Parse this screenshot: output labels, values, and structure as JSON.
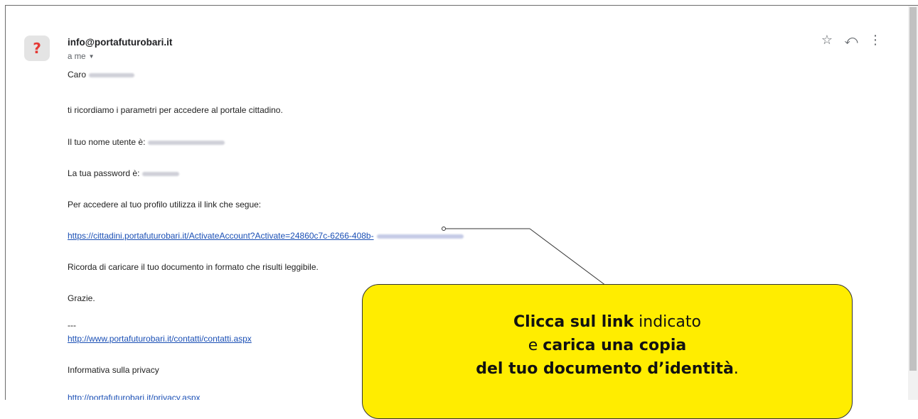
{
  "email": {
    "sender": "info@portafuturobari.it",
    "recipient": "a me",
    "avatar_glyph": "?",
    "greeting": "Caro",
    "line_reminder": "ti ricordiamo i parametri per accedere al portale cittadino.",
    "username_label": "Il tuo nome utente è:",
    "password_label": "La tua password è:",
    "profile_line": "Per accedere al tuo profilo utilizza il link che segue:",
    "activation_link": "https://cittadini.portafuturobari.it/ActivateAccount?Activate=24860c7c-6266-408b-",
    "reminder_document": "Ricorda di caricare il tuo documento in formato che risulti leggibile.",
    "thanks": "Grazie.",
    "separator": "---",
    "contact_link": "http://www.portafuturobari.it/contatti/contatti.aspx",
    "privacy_label": "Informativa sulla privacy",
    "privacy_link": "http://portafuturobari.it/privacy.aspx"
  },
  "actions": {
    "star_icon": "☆",
    "reply_icon": "⤺",
    "more_icon": "⋮"
  },
  "callout": {
    "line1_bold": "Clicca sul link",
    "line1_light": " indicato",
    "line2_light": "e ",
    "line2_bold": "carica una copia",
    "line3_bold": "del tuo documento d’identità",
    "line3_end": "."
  },
  "colors": {
    "callout_bg": "#ffed00",
    "link": "#1a4fb5",
    "avatar_glyph": "#e53935"
  }
}
